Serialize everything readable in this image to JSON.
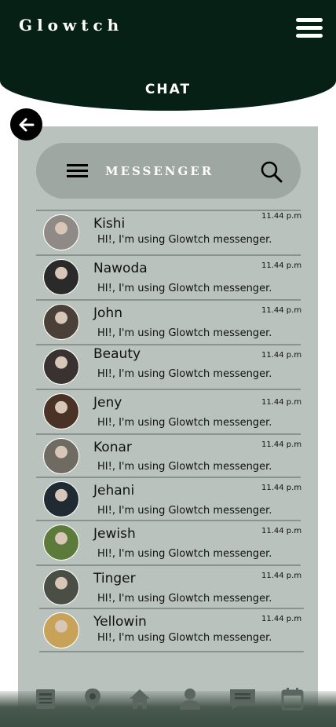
{
  "app": {
    "brand": "Glowtch",
    "title": "CHAT"
  },
  "messenger": {
    "label": "MESSENGER"
  },
  "chats": [
    {
      "name": "Kishi",
      "status": "HI!, I'm using Glowtch messenger.",
      "time": "11.44 p.m",
      "avatar_color": "#8f8a85"
    },
    {
      "name": "Nawoda",
      "status": "HI!, I'm using Glowtch messenger.",
      "time": "11.44 p.m",
      "avatar_color": "#2a2a2a"
    },
    {
      "name": "John",
      "status": "HI!, I'm using Glowtch messenger.",
      "time": "11.44 p.m",
      "avatar_color": "#4b4038"
    },
    {
      "name": "Beauty",
      "status": "HI!, I'm using Glowtch messenger.",
      "time": "11.44 p.m",
      "avatar_color": "#3a3230"
    },
    {
      "name": "Jeny",
      "status": "HI!, I'm using Glowtch messenger.",
      "time": "11.44 p.m",
      "avatar_color": "#4a3326"
    },
    {
      "name": "Konar",
      "status": "HI!, I'm using Glowtch messenger.",
      "time": "11.44 p.m",
      "avatar_color": "#6f6b62"
    },
    {
      "name": "Jehani",
      "status": "HI!, I'm using Glowtch messenger.",
      "time": "11.44 p.m",
      "avatar_color": "#1f2a33"
    },
    {
      "name": "Jewish",
      "status": "HI!, I'm using Glowtch messenger.",
      "time": "11.44 p.m",
      "avatar_color": "#5c7a3a"
    },
    {
      "name": "Tinger",
      "status": "HI!, I'm using Glowtch messenger.",
      "time": "11.44 p.m",
      "avatar_color": "#4a4e44"
    },
    {
      "name": "Yellowin",
      "status": "HI!, I'm using Glowtch messenger.",
      "time": "11.44 p.m",
      "avatar_color": "#c9a25a"
    }
  ],
  "nav": [
    {
      "icon": "news-icon"
    },
    {
      "icon": "location-pin-icon"
    },
    {
      "icon": "home-icon"
    },
    {
      "icon": "user-icon"
    },
    {
      "icon": "chat-bubble-icon"
    },
    {
      "icon": "calendar-icon"
    }
  ],
  "colors": {
    "header": "#062016",
    "panel": "#b9c2bd",
    "bar": "#9ea7a2"
  }
}
